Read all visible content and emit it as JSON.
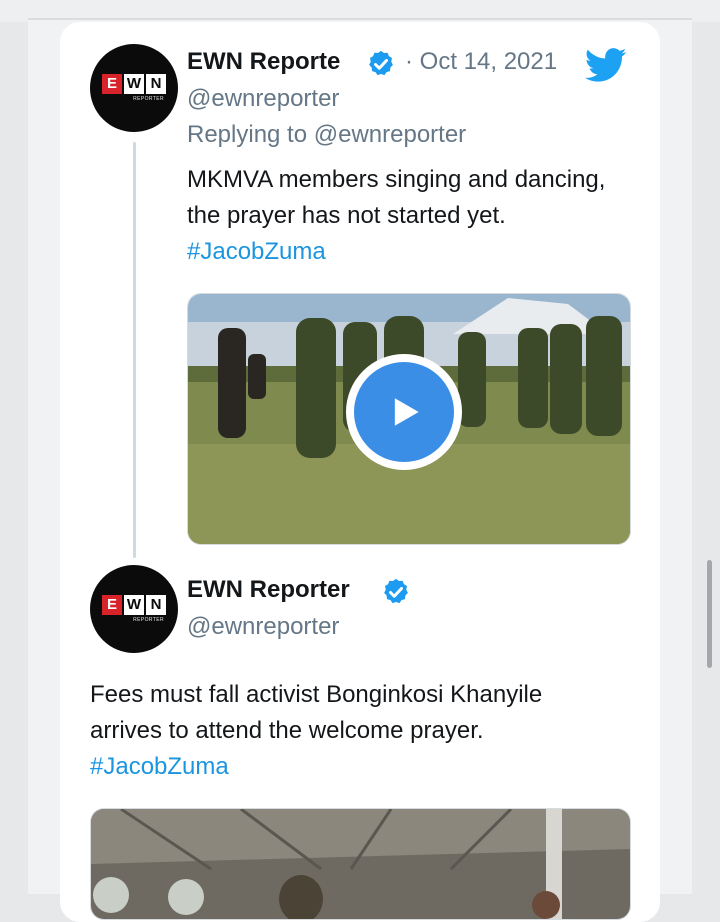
{
  "tweets": [
    {
      "name": "EWN Reporte",
      "separator": "·",
      "date": "Oct 14, 2021",
      "handle": "@ewnreporter",
      "reply_prefix": "Replying to ",
      "reply_handle": "@ewnreporter",
      "text": "MKMVA members singing and dancing, the prayer has not started yet. ",
      "hashtag": "#JacobZuma",
      "media_type": "video"
    },
    {
      "name": "EWN Reporter",
      "handle": "@ewnreporter",
      "text_line1": "Fees must fall activist Bonginkosi Khanyile",
      "text_line2": "arrives to attend the welcome prayer.",
      "hashtag": "#JacobZuma",
      "media_type": "image"
    }
  ],
  "avatar": {
    "logo_letters": [
      "E",
      "W",
      "N"
    ],
    "logo_sub": "REPORTER"
  },
  "icons": {
    "verified": "verified-badge-icon",
    "brand": "twitter-bird-icon",
    "play": "play-icon"
  },
  "colors": {
    "link": "#1b95e0",
    "verified": "#1d9bf0",
    "play": "#3a8ee6",
    "brand_red": "#d9232b"
  }
}
